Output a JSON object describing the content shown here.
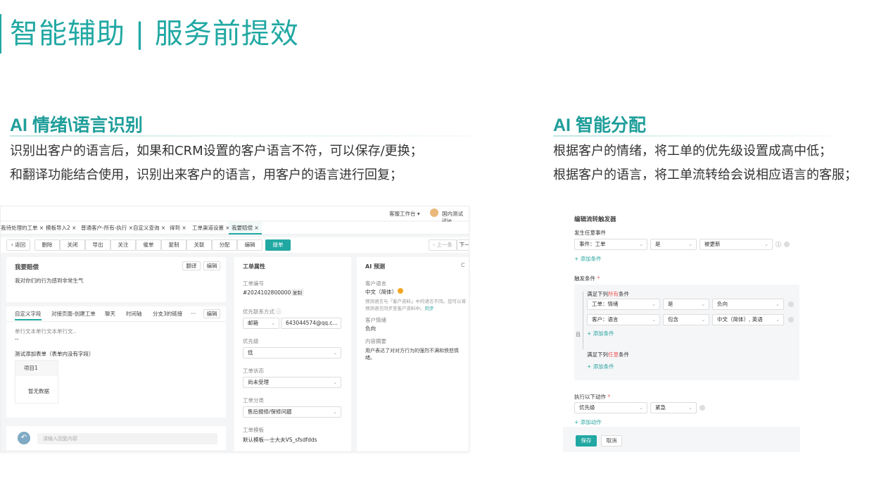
{
  "header": {
    "title": "智能辅助 | 服务前提效"
  },
  "left": {
    "title": "AI 情绪\\语言识别",
    "lines": [
      "识别出客户的语言后，如果和CRM设置的客户语言不符，可以保存/更换；",
      "和翻译功能结合使用，识别出来客户的语言，用客户的语言进行回复；"
    ],
    "shot": {
      "workspace": "客服工作台",
      "user": "国内测试iitie",
      "tabs": [
        "我待处理的工单",
        "模板导入2",
        "普通客户-所有-执行",
        "自定义查询",
        "得到",
        "工单渠道设置",
        "我要赔偿"
      ],
      "toolbar": {
        "back": "返回",
        "buttons": [
          "删除",
          "关闭",
          "导出",
          "关注",
          "催单",
          "复制",
          "关联",
          "分配",
          "编辑"
        ],
        "submit": "提单",
        "prev": "上一条",
        "next": "下一"
      },
      "ticket": {
        "title": "我要赔偿",
        "translate": "翻译",
        "edit": "编辑",
        "content": "我对你们的行为感到非常生气"
      },
      "subtabs": [
        "自定义字段",
        "对接页面-创建工单",
        "聊天",
        "时间轴",
        "分支3的链接",
        "···"
      ],
      "subedit": "编辑",
      "fields": {
        "single": "单行文本单行文本单行文..",
        "dash": "--",
        "table_title": "测试添加表单（表单内没有字段）",
        "item": "项目1",
        "empty": "暂无数据"
      },
      "reply": {
        "placeholder": "请输入回复内容"
      },
      "attrs": {
        "title": "工单属性",
        "no_label": "工单编号",
        "no": "#20241028000004",
        "copy": "复制",
        "contact_label": "优先联系方式",
        "contact_type": "邮箱",
        "contact_value": "643044574@qq.c...",
        "priority_label": "优先级",
        "priority": "低",
        "status_label": "工单状态",
        "status": "尚未受理",
        "class_label": "工单分类",
        "class": "售后报修/保修问题",
        "tpl_label": "工单模板",
        "tpl": "默认模板---士大夫VS_sfsdfdds"
      },
      "ai": {
        "title": "AI 预测",
        "refresh": "C",
        "lang_label": "客户语言",
        "lang": "中文（简体）",
        "lang_note": "预测语言与「客户资料」中的语言不同。您可以将预测语言同步至客户资料中。",
        "sync": "同步",
        "emotion_label": "客户情绪",
        "emotion": "负向",
        "summary_label": "内容摘要",
        "summary": "用户表达了对对方行为的强烈不满和愤怒情绪。"
      }
    }
  },
  "right": {
    "title": "AI 智能分配",
    "lines": [
      "根据客户的情绪，将工单的优先级设置成高中低；",
      "根据客户的语言，将工单流转给会说相应语言的客服；"
    ],
    "shot": {
      "title": "编辑流转触发器",
      "event_label": "发生任意事件",
      "event": [
        "事件：工单",
        "是",
        "被更新"
      ],
      "add_condition": "+ 添加条件",
      "trigger_label": "触发条件",
      "req": "*",
      "all_prefix": "满足下列",
      "all": "所有",
      "suffix": "条件",
      "cond1": [
        "工单：情绪",
        "是",
        "负向"
      ],
      "cond2": [
        "客户：语言",
        "包含",
        "中文（简体）, 英语"
      ],
      "and": "且",
      "any": "任意",
      "action_label": "执行以下动作",
      "action": [
        "优先级",
        "紧急"
      ],
      "add_action": "+ 添加动作",
      "save": "保存",
      "cancel": "取消"
    }
  },
  "colors": {
    "accent": "#21a8a3"
  }
}
